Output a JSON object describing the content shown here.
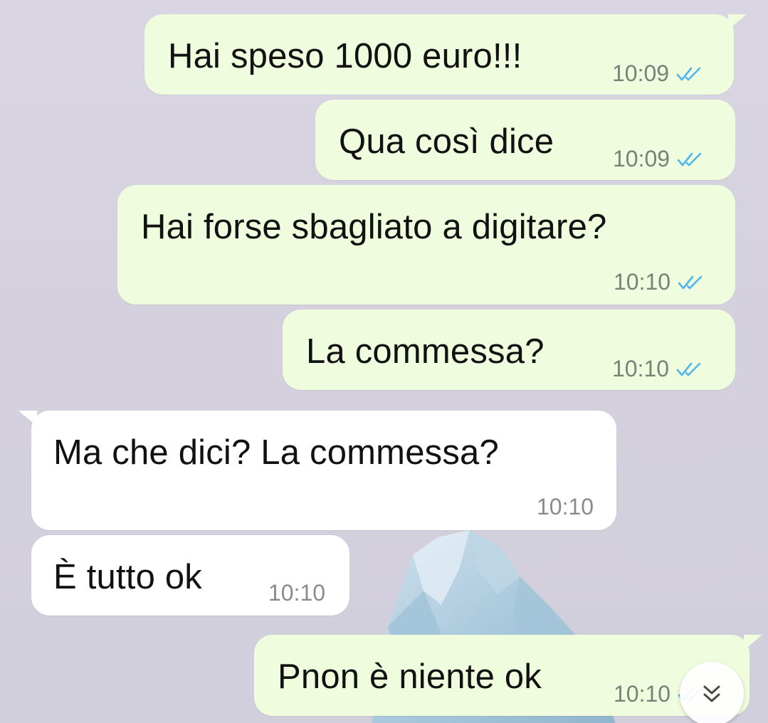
{
  "messages": [
    {
      "direction": "out",
      "text": "Hai speso 1000 euro!!!",
      "time": "10:09",
      "status": "read"
    },
    {
      "direction": "out",
      "text": "Qua così dice",
      "time": "10:09",
      "status": "read"
    },
    {
      "direction": "out",
      "text": "Hai forse sbagliato a digitare?",
      "time": "10:10",
      "status": "read"
    },
    {
      "direction": "out",
      "text": "La commessa?",
      "time": "10:10",
      "status": "read"
    },
    {
      "direction": "in",
      "text": "Ma che dici? La commessa?",
      "time": "10:10"
    },
    {
      "direction": "in",
      "text": "È tutto ok",
      "time": "10:10"
    },
    {
      "direction": "out",
      "text": "Pnon è niente ok",
      "time": "10:10",
      "status": "read"
    }
  ],
  "icons": {
    "read_ticks": "double-check-icon",
    "scroll_down": "double-chevron-down-icon",
    "wallpaper": "iceberg"
  },
  "colors": {
    "outgoing_bubble": "#effcdd",
    "incoming_bubble": "#ffffff",
    "read_tick": "#4fb6ec",
    "chat_background": "#d6d2df"
  }
}
